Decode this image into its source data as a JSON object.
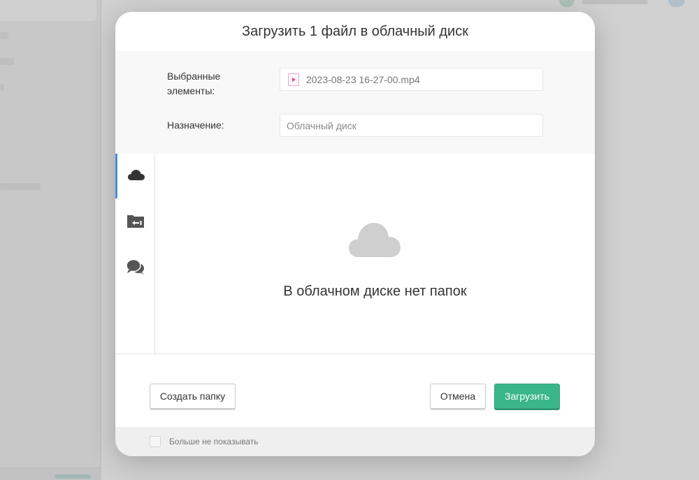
{
  "dialog": {
    "title": "Загрузить 1 файл в облачный диск",
    "selected_label": "Выбранные элементы:",
    "selected_file": "2023-08-23 16-27-00.mp4",
    "destination_label": "Назначение:",
    "destination_placeholder": "Облачный диск",
    "tabs": [
      {
        "icon": "cloud-icon",
        "active": true
      },
      {
        "icon": "folder-upload-icon",
        "active": false
      },
      {
        "icon": "chat-bubbles-icon",
        "active": false
      }
    ],
    "empty_text": "В облачном диске нет папок",
    "create_folder_label": "Создать папку",
    "cancel_label": "Отмена",
    "upload_label": "Загрузить",
    "dont_show_label": "Больше не показывать",
    "dont_show_checked": false
  },
  "colors": {
    "primary": "#3bb58a",
    "active_tab": "#4a90d9",
    "file_icon": "#d0508f"
  }
}
